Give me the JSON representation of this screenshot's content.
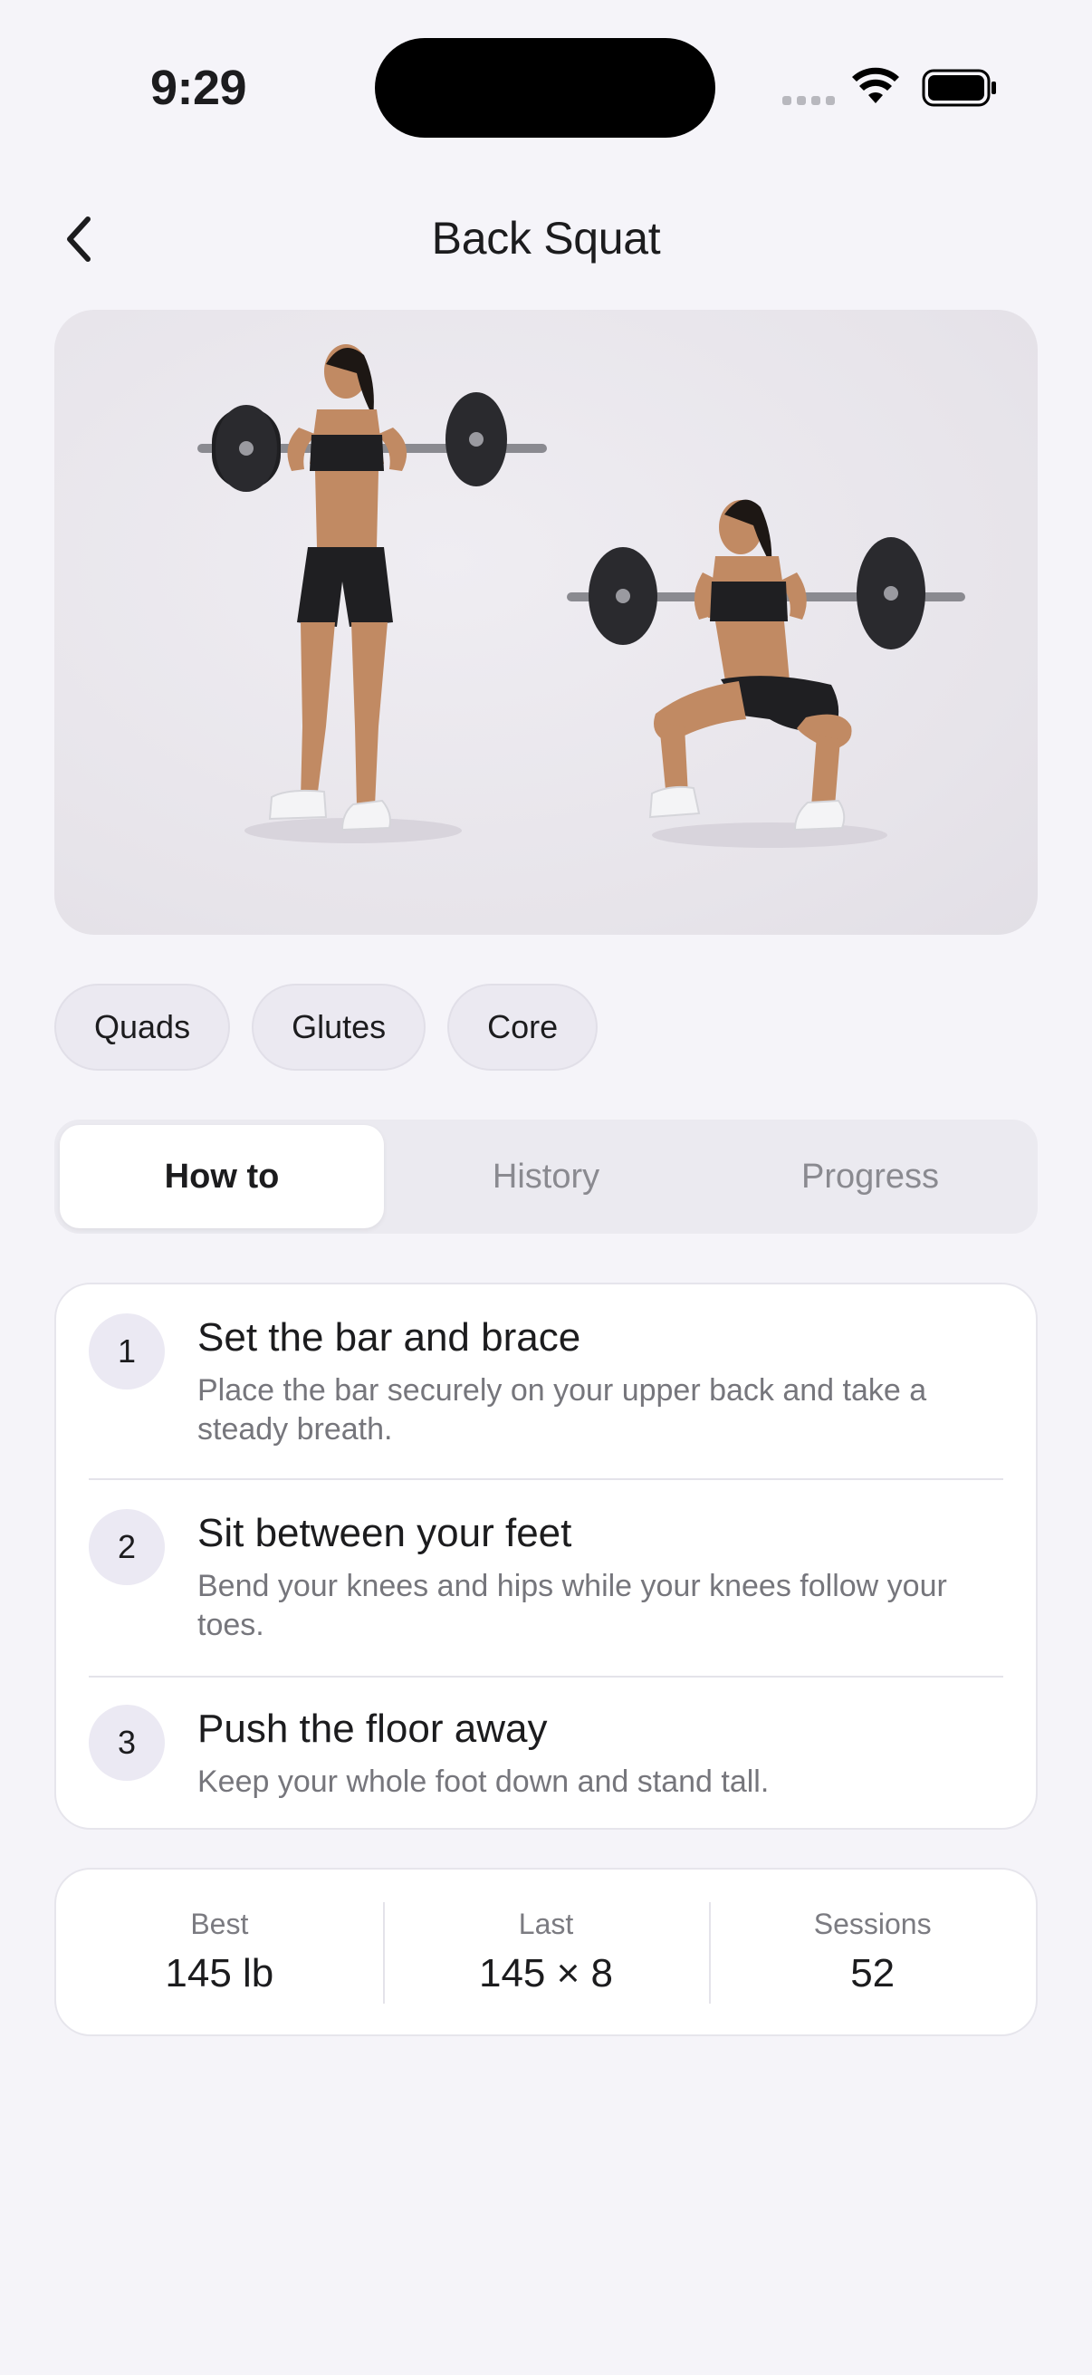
{
  "status": {
    "time": "9:29"
  },
  "nav": {
    "title": "Back Squat"
  },
  "tags": [
    "Quads",
    "Glutes",
    "Core"
  ],
  "tabs": [
    {
      "label": "How to",
      "active": true
    },
    {
      "label": "History",
      "active": false
    },
    {
      "label": "Progress",
      "active": false
    }
  ],
  "steps": [
    {
      "number": "1",
      "title": "Set the bar and brace",
      "description": "Place the bar securely on your upper back and take a steady breath."
    },
    {
      "number": "2",
      "title": "Sit between your feet",
      "description": "Bend your knees and hips while your knees follow your toes."
    },
    {
      "number": "3",
      "title": "Push the floor away",
      "description": "Keep your whole foot down and stand tall."
    }
  ],
  "stats": [
    {
      "label": "Best",
      "value": "145 lb"
    },
    {
      "label": "Last",
      "value": "145 × 8"
    },
    {
      "label": "Sessions",
      "value": "52"
    }
  ],
  "icons": {
    "back": "chevron-left-icon",
    "wifi": "wifi-icon",
    "battery": "battery-icon",
    "signal": "cellular-signal-icon"
  },
  "colors": {
    "background": "#f5f4f9",
    "card": "#ffffff",
    "chip": "#ebe9f1",
    "text_primary": "#1c1c1e",
    "text_secondary": "#76767c"
  }
}
